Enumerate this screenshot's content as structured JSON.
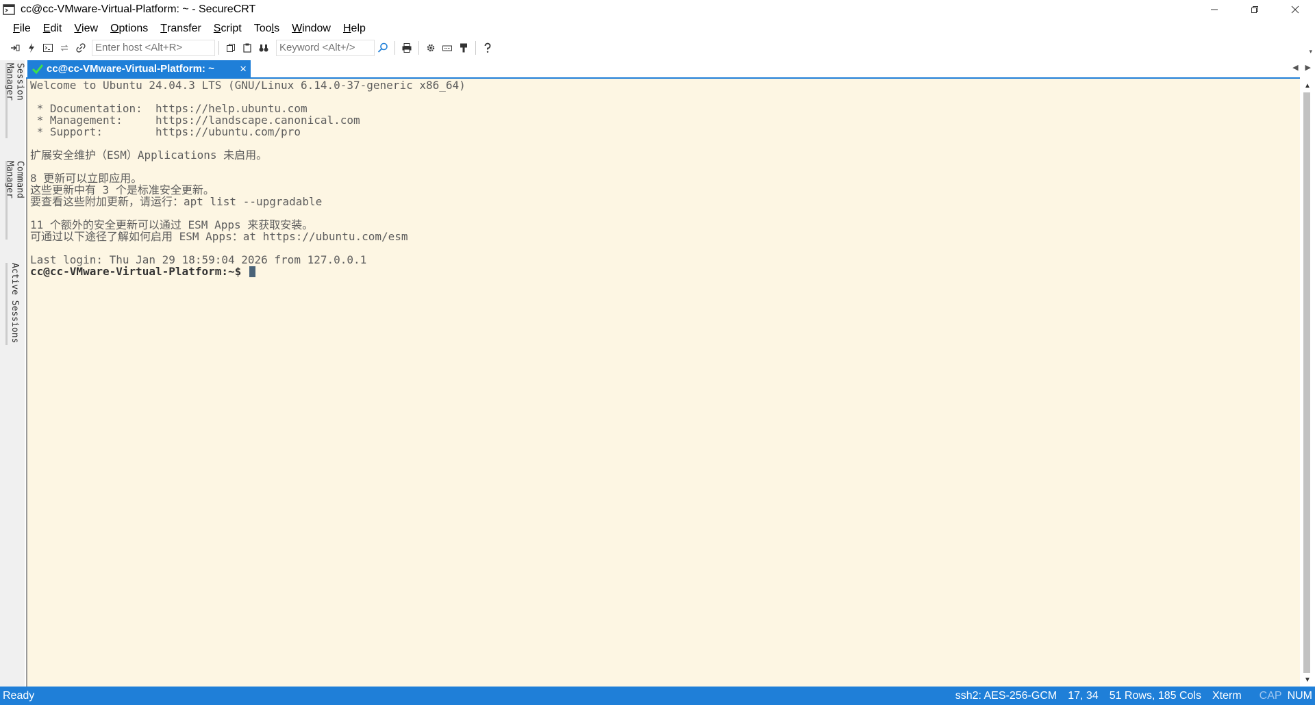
{
  "window": {
    "title": "cc@cc-VMware-Virtual-Platform: ~ - SecureCRT"
  },
  "menu": {
    "items": [
      {
        "first": "F",
        "rest": "ile"
      },
      {
        "first": "E",
        "rest": "dit"
      },
      {
        "first": "V",
        "rest": "iew"
      },
      {
        "first": "O",
        "rest": "ptions"
      },
      {
        "first": "T",
        "rest": "ransfer"
      },
      {
        "first": "S",
        "rest": "cript"
      },
      {
        "first": "",
        "rest": "Tools",
        "underline_index": 3
      },
      {
        "first": "W",
        "rest": "indow"
      },
      {
        "first": "H",
        "rest": "elp"
      }
    ]
  },
  "toolbar": {
    "host_placeholder": "Enter host <Alt+R>",
    "keyword_placeholder": "Keyword <Alt+/>"
  },
  "sidebar": {
    "tabs": [
      "Session Manager",
      "Command Manager",
      "Active Sessions"
    ]
  },
  "tabs": {
    "active_label": "cc@cc-VMware-Virtual-Platform: ~",
    "close_glyph": "×"
  },
  "terminal": {
    "lines": [
      "Welcome to Ubuntu 24.04.3 LTS (GNU/Linux 6.14.0-37-generic x86_64)",
      "",
      " * Documentation:  https://help.ubuntu.com",
      " * Management:     https://landscape.canonical.com",
      " * Support:        https://ubuntu.com/pro",
      "",
      "扩展安全维护（ESM）Applications 未启用。",
      "",
      "8 更新可以立即应用。",
      "这些更新中有 3 个是标准安全更新。",
      "要查看这些附加更新，请运行：apt list --upgradable",
      "",
      "11 个额外的安全更新可以通过 ESM Apps 来获取安装。",
      "可通过以下途径了解如何启用 ESM Apps：at https://ubuntu.com/esm",
      "",
      "Last login: Thu Jan 29 18:59:04 2026 from 127.0.0.1"
    ],
    "prompt": "cc@cc-VMware-Virtual-Platform:~$ "
  },
  "status": {
    "left": "Ready",
    "cipher": "ssh2: AES-256-GCM",
    "cursor_pos": "17, 34",
    "size": "51 Rows, 185 Cols",
    "term_type": "Xterm",
    "cap": "CAP",
    "num": "NUM"
  },
  "colors": {
    "accent": "#1f7fd8",
    "terminal_bg": "#fdf6e3",
    "terminal_fg": "#5d5d5d"
  }
}
